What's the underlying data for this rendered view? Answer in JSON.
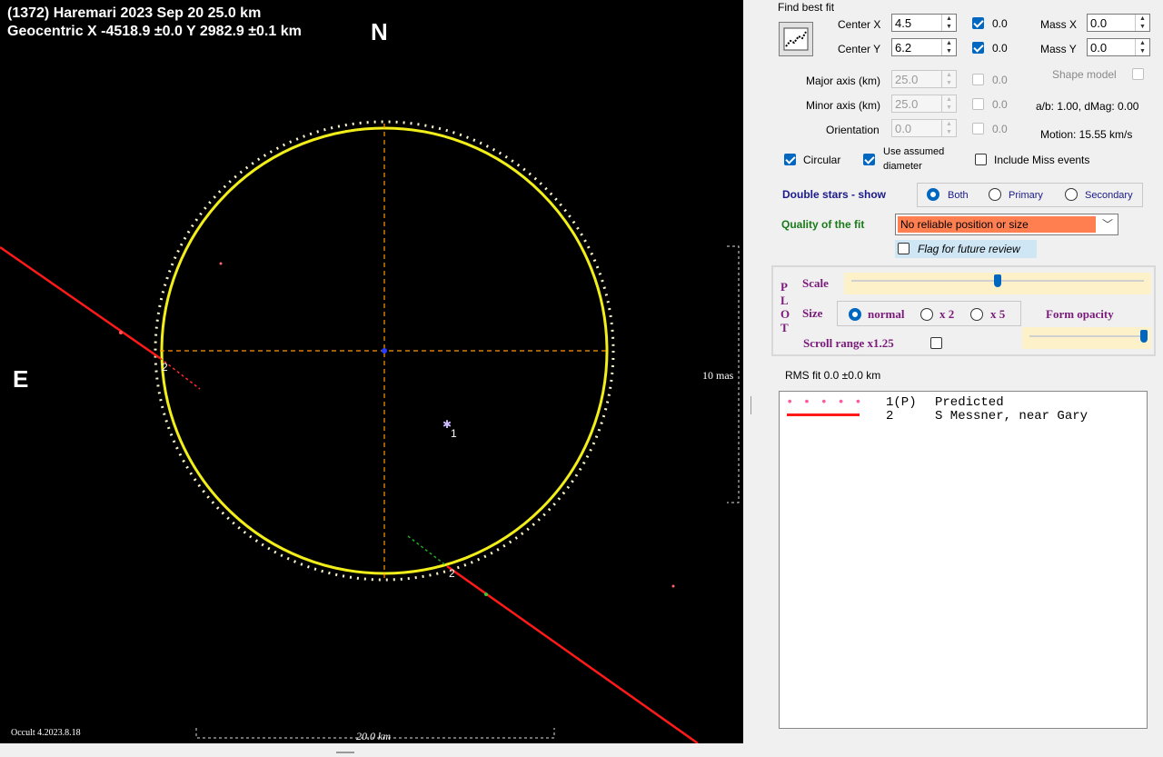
{
  "plot": {
    "header_line1": "(1372) Haremari  2023 Sep 20   25.0 km",
    "header_line2": "Geocentric  X  -4518.9 ±0.0  Y 2982.9 ±0.1 km",
    "north_label": "N",
    "east_label": "E",
    "version": "Occult 4.2023.8.18",
    "scale_vertical": "10 mas",
    "scale_horizontal": "20.0 km",
    "chord_label_left": "2",
    "chord_label_bottom": "2",
    "star_label": "1",
    "colors": {
      "background": "#000000",
      "limb": "#ffff00",
      "chord": "#ff0000",
      "axes": "#ff9900"
    }
  },
  "fit": {
    "group_title": "Find best fit",
    "center_x_label": "Center X",
    "center_x_value": "4.5",
    "center_x_check": "0.0",
    "center_y_label": "Center Y",
    "center_y_value": "6.2",
    "center_y_check": "0.0",
    "mass_x_label": "Mass X",
    "mass_x_value": "0.0",
    "mass_y_label": "Mass Y",
    "mass_y_value": "0.0",
    "shape_model_label": "Shape model",
    "major_axis_label": "Major axis (km)",
    "major_axis_value": "25.0",
    "major_axis_check": "0.0",
    "minor_axis_label": "Minor axis (km)",
    "minor_axis_value": "25.0",
    "minor_axis_check": "0.0",
    "orientation_label": "Orientation",
    "orientation_value": "0.0",
    "orientation_check": "0.0",
    "ab_text": "a/b: 1.00, dMag: 0.00",
    "motion_text": "Motion: 15.55 km/s",
    "circular_label": "Circular",
    "assumed_label_1": "Use assumed",
    "assumed_label_2": "diameter",
    "miss_label": "Include Miss events",
    "double_stars_label": "Double stars - show",
    "both_label": "Both",
    "primary_label": "Primary",
    "secondary_label": "Secondary",
    "quality_label": "Quality of the fit",
    "quality_value": "No reliable position or size",
    "flag_label": "Flag for future review"
  },
  "plotctl": {
    "side_letters": [
      "P",
      "L",
      "O",
      "T"
    ],
    "scale_label": "Scale",
    "size_label": "Size",
    "normal_label": "normal",
    "x2_label": "x 2",
    "x5_label": "x 5",
    "form_opacity_label": "Form opacity",
    "scroll_label": "Scroll range x1.25",
    "scale_slider": 0.5,
    "opacity_slider": 1.0
  },
  "rms": "RMS fit 0.0 ±0.0 km",
  "legend": [
    {
      "marker": "• • • • •",
      "id": "1(P)",
      "name": "Predicted"
    },
    {
      "marker": "line",
      "id": "2",
      "name": "S Messner, near Gary"
    }
  ]
}
